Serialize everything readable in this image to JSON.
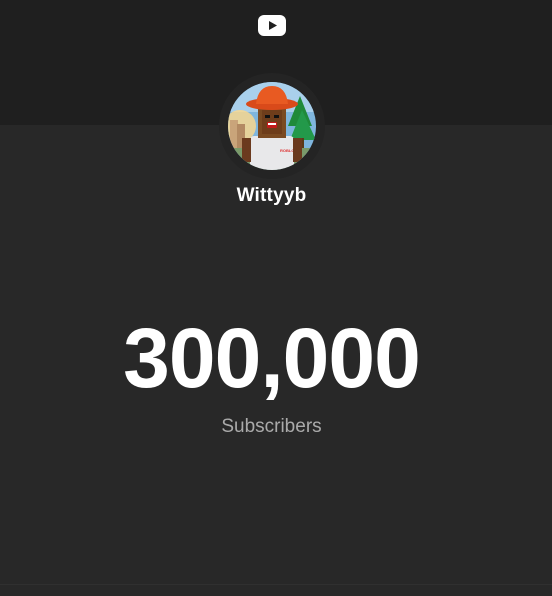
{
  "header": {
    "logo_icon": "youtube-play-icon"
  },
  "channel": {
    "name": "Wittyyb",
    "avatar_icon": "channel-avatar"
  },
  "stats": {
    "subscriber_count": "300,000",
    "subscriber_label": "Subscribers"
  }
}
